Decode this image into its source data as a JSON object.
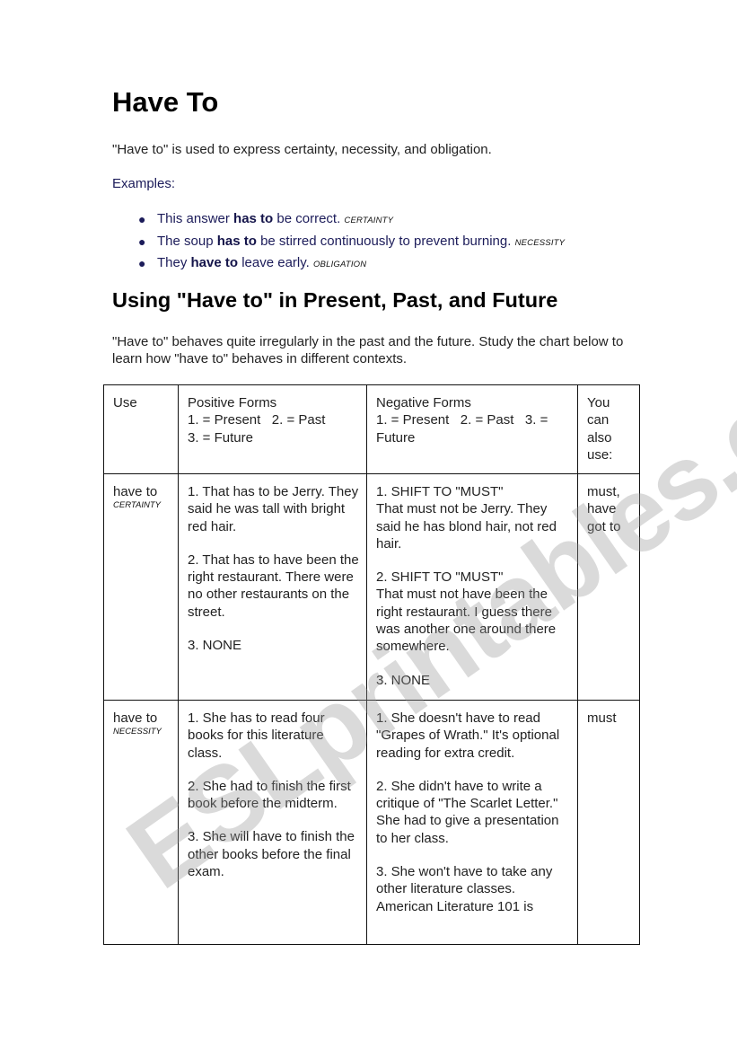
{
  "title": "Have To",
  "intro": "\"Have to\" is used to express certainty, necessity, and obligation.",
  "examples_label": "Examples:",
  "examples": [
    {
      "before": "This answer ",
      "bold": "has to",
      "after": " be correct. ",
      "tag": "CERTAINTY"
    },
    {
      "before": "The soup ",
      "bold": "has to",
      "after": " be stirred continuously to prevent burning. ",
      "tag": "NECESSITY"
    },
    {
      "before": "They ",
      "bold": "have to",
      "after": " leave early. ",
      "tag": "OBLIGATION"
    }
  ],
  "section_heading": "Using \"Have to\" in Present, Past, and Future",
  "section_paragraph": "\"Have to\" behaves quite irregularly in the past and the future. Study the chart below to learn how \"have to\" behaves in different contexts.",
  "table": {
    "headers": {
      "use": "Use",
      "positive_title": "Positive Forms",
      "positive_key_1": "1. = Present   2. = Past",
      "positive_key_2": "3. = Future",
      "negative_title": "Negative Forms",
      "negative_key_1": "1. = Present   2. = Past   3. =",
      "negative_key_2": "Future",
      "also_1": "You",
      "also_2": "can",
      "also_3": "also",
      "also_4": "use:"
    },
    "rows": [
      {
        "use": "have to",
        "use_tag": "CERTAINTY",
        "positive": [
          "1. That has to be Jerry. They said he was tall with bright red hair.",
          "2. That has to have been the right restaurant. There were no other restaurants on the street.",
          "3. NONE"
        ],
        "negative": [
          {
            "head": "1. SHIFT TO \"MUST\"",
            "body": "That must not be Jerry. They said he has blond hair, not red hair."
          },
          {
            "head": "2. SHIFT TO \"MUST\"",
            "body": "That must not have been the right restaurant. I guess there was another one around there somewhere."
          },
          {
            "head": "3. NONE",
            "body": ""
          }
        ],
        "also": "must, have got to"
      },
      {
        "use": "have to",
        "use_tag": "NECESSITY",
        "positive": [
          "1. She has to read four books for this literature class.",
          "2. She had to finish the first book before the midterm.",
          "3. She will have to finish the other books before the final exam."
        ],
        "negative": [
          {
            "head": "",
            "body": "1. She doesn't have to read \"Grapes of Wrath.\" It's optional reading for extra credit."
          },
          {
            "head": "",
            "body": "2. She didn't have to write a critique of \"The Scarlet Letter.\" She had to give a presentation to her class."
          },
          {
            "head": "",
            "body": "3. She won't have to take any other literature classes. American Literature 101 is"
          }
        ],
        "also": "must"
      }
    ]
  },
  "watermark": "ESLprintables.com"
}
